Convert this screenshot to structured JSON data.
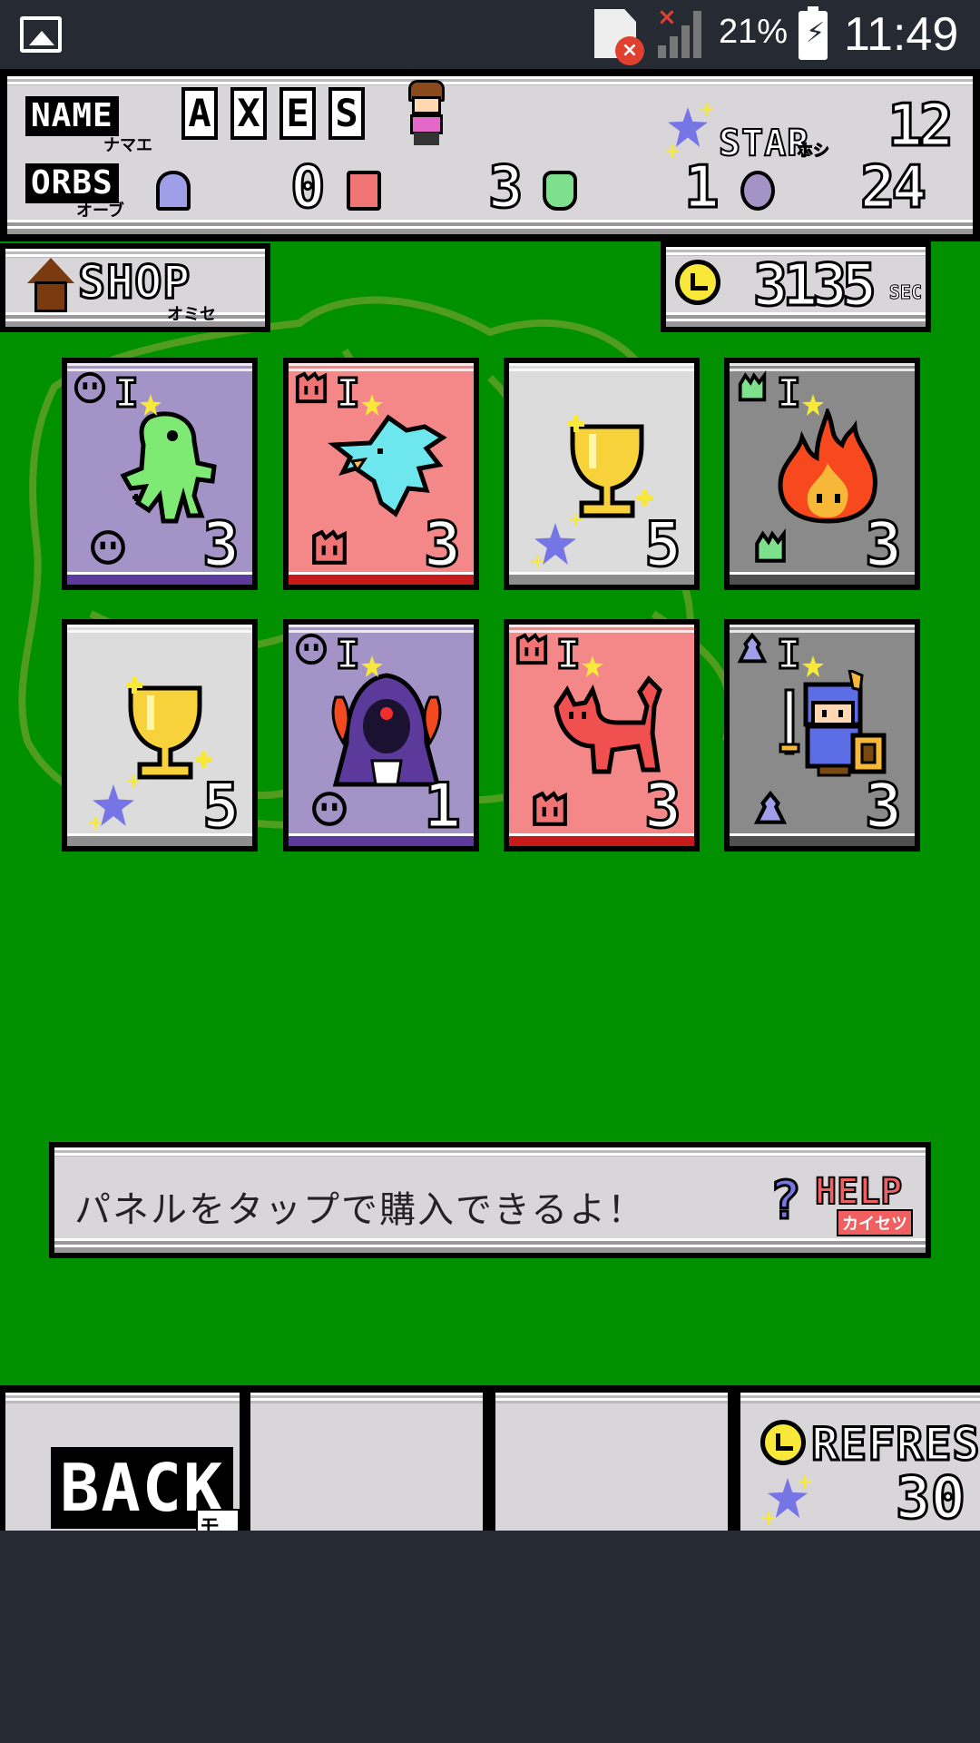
{
  "status_bar": {
    "battery_percent": "21%",
    "time": "11:49"
  },
  "player": {
    "name_label": "NAME",
    "name_kana": "ナマエ",
    "name_letters": [
      "A",
      "X",
      "E",
      "S"
    ],
    "orbs_label": "ORBS",
    "orbs_kana": "オーブ",
    "orbs": {
      "blue": "0",
      "red": "3",
      "green": "1",
      "purple": "24"
    },
    "star_label": "STAR",
    "star_kana": "ホシ",
    "star_value": "12"
  },
  "shop": {
    "label": "SHOP",
    "kana": "オミセ"
  },
  "timer": {
    "value": "3135",
    "unit": "SEC"
  },
  "cards": [
    {
      "color": "purple",
      "orb": "purple",
      "tier": "I",
      "art": "green-ghost",
      "cost": "3"
    },
    {
      "color": "red",
      "orb": "red",
      "tier": "I",
      "art": "cyan-bird",
      "cost": "3"
    },
    {
      "color": "white",
      "orb": "star",
      "tier": "",
      "art": "gold-trophy",
      "cost": "5"
    },
    {
      "color": "gray",
      "orb": "green",
      "tier": "I",
      "art": "fire",
      "cost": "3"
    },
    {
      "color": "white",
      "orb": "star",
      "tier": "",
      "art": "gold-trophy",
      "cost": "5"
    },
    {
      "color": "purple",
      "orb": "purple",
      "tier": "I",
      "art": "hooded-mage",
      "cost": "1"
    },
    {
      "color": "red",
      "orb": "red",
      "tier": "I",
      "art": "red-cat",
      "cost": "3"
    },
    {
      "color": "gray",
      "orb": "blue",
      "tier": "I",
      "art": "knight",
      "cost": "3"
    }
  ],
  "message": {
    "text": "パネルをタップで購入できるよ！",
    "help_label": "HELP",
    "help_kana": "カイセツ"
  },
  "buttons": {
    "back_label": "BACK",
    "back_kana": "モドル",
    "refresh_label": "REFRESH",
    "refresh_cost": "30"
  },
  "colors": {
    "field": "#009000",
    "panel": "#d9d6d9",
    "card_purple": "#a493c7",
    "card_red": "#f48888",
    "card_gray": "#8a8a8a",
    "card_white": "#dcdcdc",
    "gold": "#f7e83a",
    "star_blue": "#7575e6"
  }
}
